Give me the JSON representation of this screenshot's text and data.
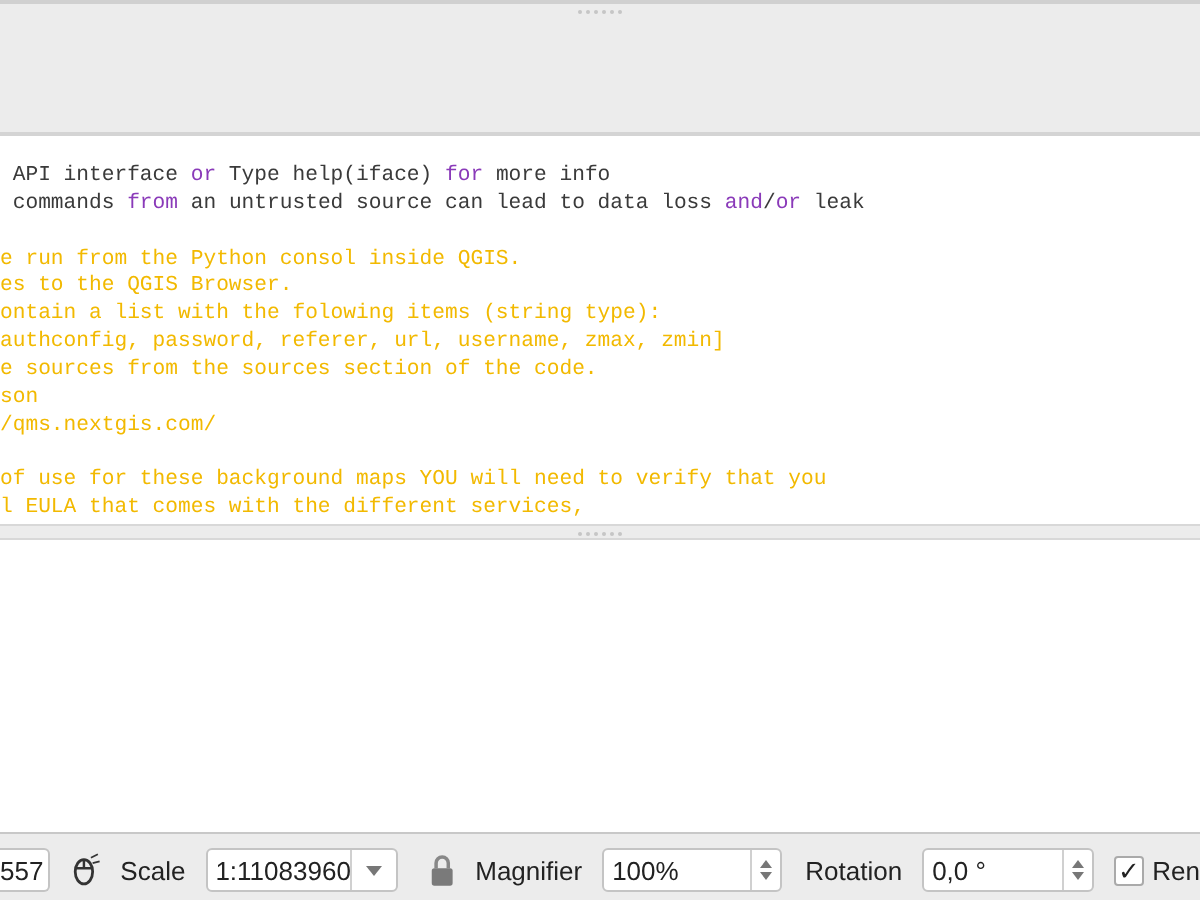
{
  "console": {
    "blocks": [
      [
        [
          {
            "text": " API interface ",
            "kind": "plain"
          },
          {
            "text": "or",
            "kind": "keyword"
          },
          {
            "text": " Type help(iface) ",
            "kind": "plain"
          },
          {
            "text": "for",
            "kind": "keyword"
          },
          {
            "text": " more info",
            "kind": "plain"
          }
        ],
        [
          {
            "text": " commands ",
            "kind": "plain"
          },
          {
            "text": "from",
            "kind": "keyword"
          },
          {
            "text": " an untrusted source can lead to data loss ",
            "kind": "plain"
          },
          {
            "text": "and",
            "kind": "keyword"
          },
          {
            "text": "/",
            "kind": "plain"
          },
          {
            "text": "or",
            "kind": "keyword"
          },
          {
            "text": " leak",
            "kind": "plain"
          }
        ]
      ],
      [
        [
          {
            "text": "e run from the Python consol inside QGIS.",
            "kind": "comment"
          }
        ],
        [
          {
            "text": "es to the QGIS Browser.",
            "kind": "comment"
          }
        ],
        [
          {
            "text": "ontain a list with the folowing items (string type):",
            "kind": "comment"
          }
        ],
        [
          {
            "text": "authconfig, password, referer, url, username, zmax, zmin]",
            "kind": "comment"
          }
        ],
        [
          {
            "text": "e sources from the sources section of the code.",
            "kind": "comment"
          }
        ],
        [
          {
            "text": "son",
            "kind": "comment"
          }
        ],
        [
          {
            "text": "/qms.nextgis.com/",
            "kind": "comment"
          }
        ]
      ],
      [
        [
          {
            "text": "of use for these background maps YOU will need to verify that you",
            "kind": "comment"
          }
        ],
        [
          {
            "text": "l EULA that comes with the different services,",
            "kind": "comment"
          }
        ]
      ]
    ]
  },
  "status_bar": {
    "coordinate": "557",
    "scale_label": "Scale",
    "scale": "1:11083960",
    "magnifier_label": "Magnifier",
    "magnifier": "100%",
    "rotation_label": "Rotation",
    "rotation": "0,0 °",
    "render": {
      "label": "Ren",
      "checked": true
    },
    "check_mark": "✓"
  }
}
